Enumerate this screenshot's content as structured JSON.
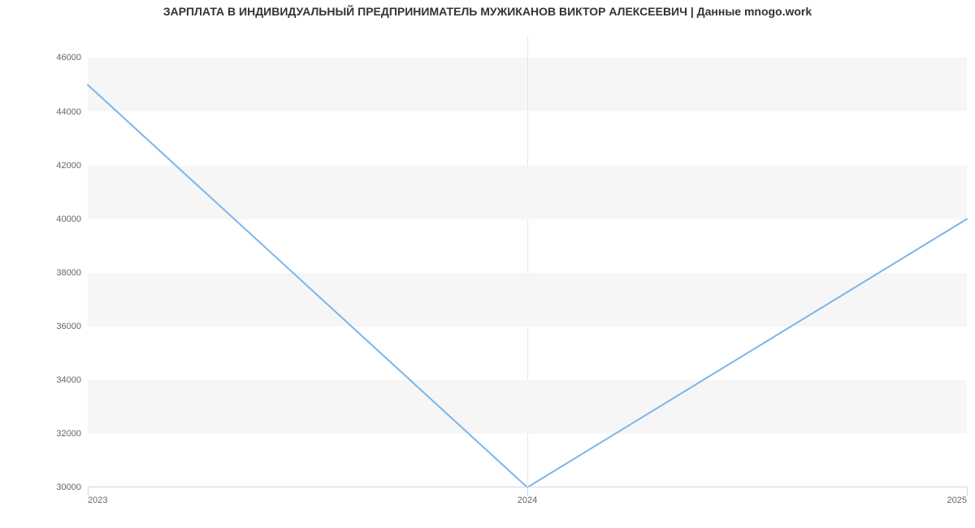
{
  "chart_data": {
    "type": "line",
    "title": "ЗАРПЛАТА В ИНДИВИДУАЛЬНЫЙ ПРЕДПРИНИМАТЕЛЬ МУЖИКАНОВ ВИКТОР АЛЕКСЕЕВИЧ | Данные mnogo.work",
    "x": [
      2023,
      2024,
      2025
    ],
    "values": [
      45000,
      30000,
      40000
    ],
    "y_ticks": [
      30000,
      32000,
      34000,
      36000,
      38000,
      40000,
      42000,
      44000,
      46000
    ],
    "x_ticks": [
      2023,
      2024,
      2025
    ],
    "ylim": [
      30000,
      46800
    ],
    "xlabel": "",
    "ylabel": "",
    "line_color": "#7cb5ec"
  }
}
